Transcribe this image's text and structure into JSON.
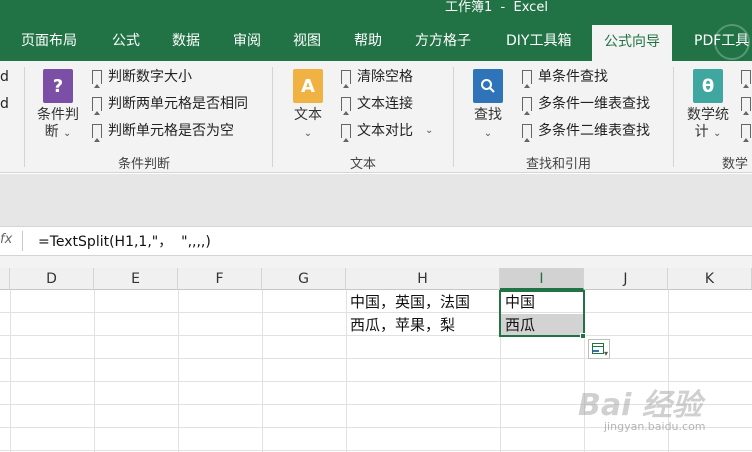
{
  "window": {
    "title": "工作簿1  -  Excel"
  },
  "tabs": [
    {
      "label": "页面布局"
    },
    {
      "label": "公式"
    },
    {
      "label": "数据"
    },
    {
      "label": "审阅"
    },
    {
      "label": "视图"
    },
    {
      "label": "帮助"
    },
    {
      "label": "方方格子"
    },
    {
      "label": "DIY工具箱"
    },
    {
      "label": "公式向导",
      "active": true
    },
    {
      "label": "PDF工具"
    }
  ],
  "ribbon": {
    "edge_items": [
      "d",
      "d"
    ],
    "condition_group": {
      "label": "条件判断",
      "big_label_1": "条件判",
      "big_label_2": "断",
      "items": [
        "判断数字大小",
        "判断两单元格是否相同",
        "判断单元格是否为空"
      ]
    },
    "text_group": {
      "label": "文本",
      "big_label": "文本",
      "icon_glyph": "A",
      "items": [
        "清除空格",
        "文本连接",
        "文本对比"
      ]
    },
    "lookup_group": {
      "label": "查找和引用",
      "big_label": "查找",
      "items": [
        "单条件查找",
        "多条件一维表查找",
        "多条件二维表查找"
      ]
    },
    "math_group": {
      "label": "数学",
      "big_label_1": "数学统",
      "big_label_2": "计",
      "icon_glyph": "θ"
    }
  },
  "formula_bar": {
    "fx_label": "fx",
    "formula": "=TextSplit(H1,1,\"，  \",,,,)"
  },
  "columns": [
    "D",
    "E",
    "F",
    "G",
    "H",
    "I",
    "J",
    "K"
  ],
  "selected_column": "I",
  "cells": {
    "H1": "中国，英国，法国",
    "H2": "西瓜，苹果，梨",
    "I1": "中国",
    "I2": "西瓜"
  },
  "watermark": {
    "main": "Bai 经验",
    "sub": "jingyan.baidu.com"
  },
  "colors": {
    "accent": "#217346",
    "selection_fill": "#d3d3d3"
  }
}
